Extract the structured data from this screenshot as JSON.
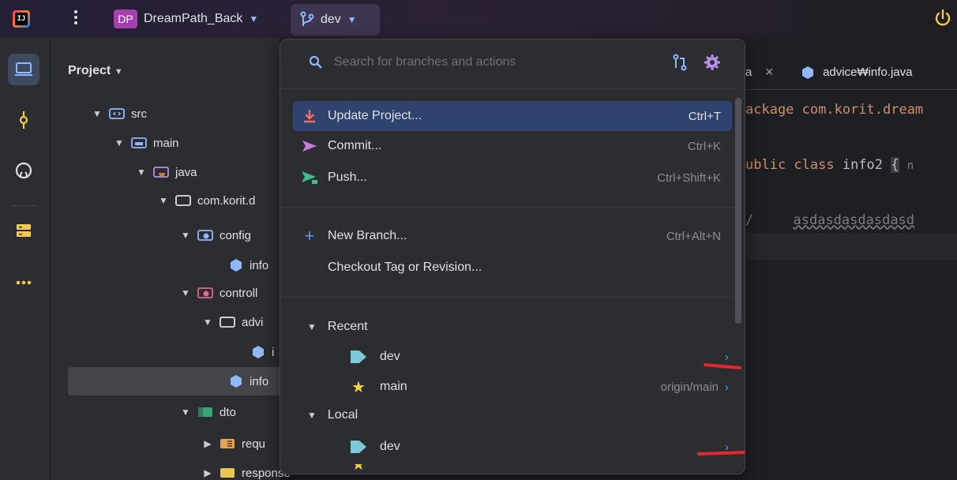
{
  "titlebar": {
    "app_icon_text": "IJ",
    "project_badge": "DP",
    "project_name": "DreamPath_Back",
    "branch": "dev"
  },
  "project_panel": {
    "title": "Project",
    "tree": [
      {
        "label": "src",
        "icon": "source-folder-icon"
      },
      {
        "label": "main",
        "icon": "folder-icon"
      },
      {
        "label": "java",
        "icon": "java-folder-icon"
      },
      {
        "label": "com.korit.d",
        "icon": "package-icon"
      },
      {
        "label": "config",
        "icon": "config-folder-icon"
      },
      {
        "label": "info",
        "icon": "class-icon"
      },
      {
        "label": "controll",
        "icon": "controller-folder-icon"
      },
      {
        "label": "advi",
        "icon": "package-icon"
      },
      {
        "label": "i",
        "icon": "class-icon"
      },
      {
        "label": "info",
        "icon": "class-icon"
      },
      {
        "label": "dto",
        "icon": "dto-folder-icon"
      },
      {
        "label": "requ",
        "icon": "folder-icon"
      },
      {
        "label": "response",
        "icon": "folder-icon"
      }
    ]
  },
  "editor": {
    "tabs": [
      {
        "label": "a"
      },
      {
        "label": "advice₩info.java"
      }
    ],
    "lines": {
      "l1": "ackage com.korit.dream",
      "l2_kw": "ublic class",
      "l2_name": "info2",
      "l2_brace": "{",
      "l2_hint": "n",
      "l3_slash": "/",
      "l3_comment": "asdasdasdasdasd"
    }
  },
  "popup": {
    "search_placeholder": "Search for branches and actions",
    "actions": [
      {
        "label": "Update Project...",
        "shortcut": "Ctrl+T",
        "icon": "update-icon"
      },
      {
        "label": "Commit...",
        "shortcut": "Ctrl+K",
        "icon": "commit-icon"
      },
      {
        "label": "Push...",
        "shortcut": "Ctrl+Shift+K",
        "icon": "push-icon"
      },
      {
        "label": "New Branch...",
        "shortcut": "Ctrl+Alt+N",
        "icon": "plus-icon"
      },
      {
        "label": "Checkout Tag or Revision...",
        "shortcut": "",
        "icon": ""
      }
    ],
    "recent": {
      "header": "Recent",
      "branches": [
        {
          "name": "dev",
          "tracking": "",
          "icon": "tag-icon"
        },
        {
          "name": "main",
          "tracking": "origin/main",
          "icon": "star-icon"
        }
      ]
    },
    "local": {
      "header": "Local",
      "branches": [
        {
          "name": "dev",
          "tracking": "",
          "icon": "tag-icon"
        }
      ]
    }
  },
  "colors": {
    "highlight": "#2e436e",
    "annotation_red": "#e8262e",
    "accent": "#5a9cf8"
  }
}
